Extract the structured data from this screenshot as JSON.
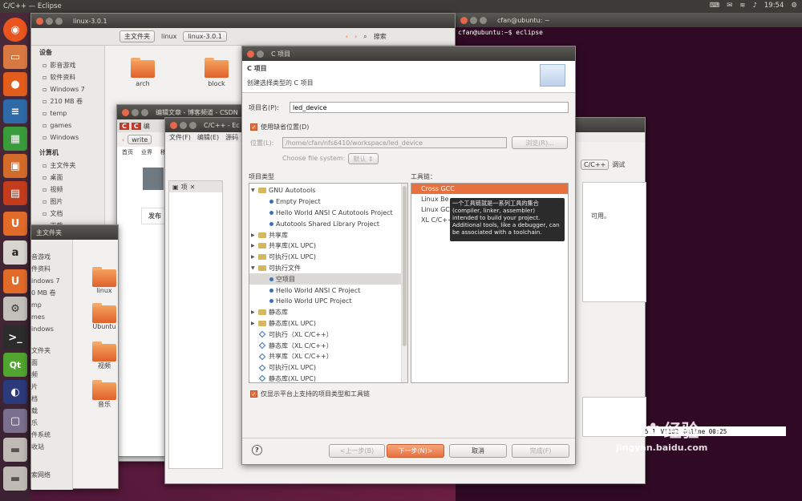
{
  "topbar": {
    "title": "C/C++ — Eclipse",
    "time": "19:54"
  },
  "files": {
    "title": "linux-3.0.1",
    "crumbs": [
      "主文件夹",
      "linux",
      "linux-3.0.1"
    ],
    "search": "搜索",
    "devices_header": "设备",
    "devices": [
      "影音游戏",
      "软件资料",
      "Windows 7",
      "210 MB 卷",
      "temp",
      "games",
      "Windows"
    ],
    "computer_header": "计算机",
    "computer": [
      "主文件夹",
      "桌面",
      "视频",
      "图片",
      "文档",
      "下载",
      "音乐"
    ],
    "items": [
      "arch",
      "block"
    ]
  },
  "files2": {
    "title": "主文件夹",
    "crumb": "主文件夹",
    "side": [
      "音游戏",
      "件资料",
      "indows 7",
      "0 MB 卷",
      "mp",
      "mes",
      "indows",
      "文件夹",
      "面",
      "频",
      "片",
      "档",
      "载",
      "乐",
      "件系统",
      "收站",
      "索网络"
    ],
    "items": [
      "linux",
      "Ubuntu",
      "视频",
      "音乐"
    ]
  },
  "browser": {
    "title": "编辑文章 - 博客频道 - CSDN",
    "tab": "编",
    "url": "write",
    "nav": [
      "首页",
      "业界",
      "移"
    ],
    "publish": "发布",
    "labels": [
      "文章标题",
      "文章内容"
    ],
    "category": "原创",
    "notes": [
      "建议明了",
      "3.修改m"
    ]
  },
  "eclipse_back": {
    "title": "C/C++ - Ec",
    "menus": [
      "文件(F)",
      "编辑(E)",
      "源码"
    ],
    "tab": "项",
    "perspective": "C/C++",
    "debug": "调试",
    "text": "可用。",
    "status": [
      "5.1",
      "VT102",
      "Online 00:25"
    ]
  },
  "terminal": {
    "title": "cfan@ubuntu: ~",
    "line1": "cfan@ubuntu:~$ eclipse"
  },
  "dialog": {
    "title": "C 项目",
    "heading": "C 项目",
    "subtitle": "创建选择类型的 C 项目",
    "name_label": "项目名(P):",
    "name_value": "led_device",
    "default_loc_label": "使用缺省位置(D)",
    "location_label": "位置(L):",
    "location_value": "/home/cfan/nfs6410/workspace/led_device",
    "browse": "浏览(R)...",
    "fs_label": "Choose file system:",
    "fs_value": "默认",
    "types_header": "项目类型",
    "toolchains_header": "工具链：",
    "types": [
      {
        "label": "GNU Autotools",
        "kind": "folder-open",
        "indent": 0
      },
      {
        "label": "Empty Project",
        "kind": "dot",
        "indent": 1
      },
      {
        "label": "Hello World ANSI C Autotools Project",
        "kind": "dot",
        "indent": 1
      },
      {
        "label": "Autotools Shared Library Project",
        "kind": "dot",
        "indent": 1
      },
      {
        "label": "共享库",
        "kind": "folder",
        "indent": 0
      },
      {
        "label": "共享库(XL UPC)",
        "kind": "folder",
        "indent": 0
      },
      {
        "label": "可执行(XL UPC)",
        "kind": "folder",
        "indent": 0
      },
      {
        "label": "可执行文件",
        "kind": "folder-open",
        "indent": 0
      },
      {
        "label": "空项目",
        "kind": "dot",
        "indent": 1,
        "selected": true
      },
      {
        "label": "Hello World ANSI C Project",
        "kind": "dot",
        "indent": 1
      },
      {
        "label": "Hello World UPC Project",
        "kind": "dot",
        "indent": 1
      },
      {
        "label": "静态库",
        "kind": "folder",
        "indent": 0
      },
      {
        "label": "静态库(XL UPC)",
        "kind": "folder",
        "indent": 0
      },
      {
        "label": "可执行（XL C/C++）",
        "kind": "dia",
        "indent": 0
      },
      {
        "label": "静态库（XL C/C++）",
        "kind": "dia",
        "indent": 0
      },
      {
        "label": "共享库（XL C/C++）",
        "kind": "dia",
        "indent": 0
      },
      {
        "label": "可执行(XL UPC)",
        "kind": "dia",
        "indent": 0
      },
      {
        "label": "静态库(XL UPC)",
        "kind": "dia",
        "indent": 0
      }
    ],
    "toolchains": [
      "Cross GCC",
      "Linux Be",
      "Linux GC",
      "XL C/C++"
    ],
    "tooltip": "一个工具链就是一系列工具的集合(compiler, linker, assembler) intended to build your project. Additional tools, like a debugger, can be associated with a toolchain.",
    "filter_label": "仅显示平台上支持的项目类型和工具链",
    "back": "<上一步(B)",
    "next": "下一步(N)>",
    "cancel": "取消",
    "finish": "完成(F)",
    "help": "?"
  },
  "watermark": {
    "brand": "Bai",
    "brand2": "经验",
    "url": "jingyan.baidu.com"
  },
  "colors": {
    "accent": "#e8703e",
    "terminal": "#300a24"
  }
}
